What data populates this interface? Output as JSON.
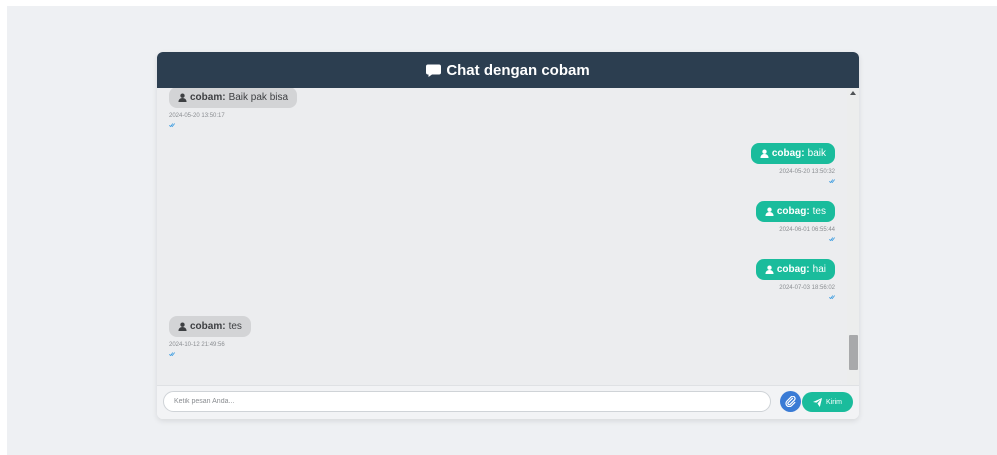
{
  "header": {
    "title": "Chat dengan cobam",
    "icon": "comment-icon"
  },
  "messages": [
    {
      "sender": "cobam",
      "text": "Baik pak bisa",
      "timestamp": "2024-05-20 13:50:17",
      "direction": "in"
    },
    {
      "sender": "cobag",
      "text": "baik",
      "timestamp": "2024-05-20 13:50:32",
      "direction": "out"
    },
    {
      "sender": "cobag",
      "text": "tes",
      "timestamp": "2024-06-01 06:55:44",
      "direction": "out"
    },
    {
      "sender": "cobag",
      "text": "hai",
      "timestamp": "2024-07-03 18:56:02",
      "direction": "out"
    },
    {
      "sender": "cobam",
      "text": "tes",
      "timestamp": "2024-10-12 21:49:56",
      "direction": "in"
    }
  ],
  "composer": {
    "placeholder": "Ketik pesan Anda...",
    "send_label": "Kirim"
  },
  "colors": {
    "header": "#2c3e50",
    "outgoing": "#1abc9c",
    "incoming": "#d3d4d6",
    "attach": "#3a7bd5",
    "read_check": "#3a9be0"
  }
}
